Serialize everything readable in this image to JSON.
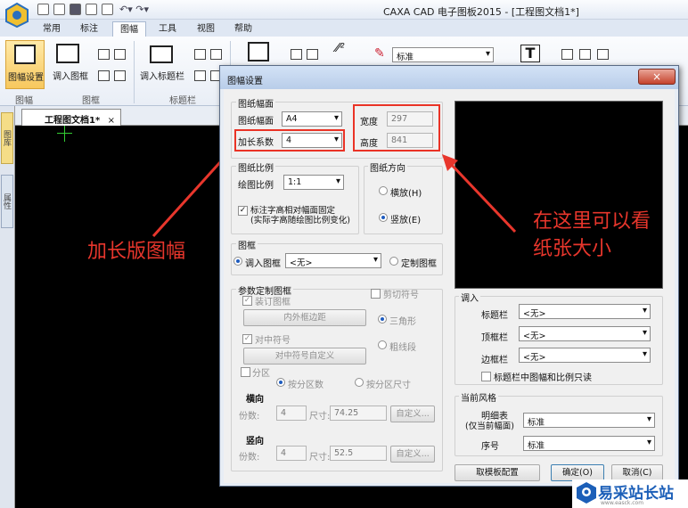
{
  "window": {
    "title": "CAXA CAD 电子图板2015 - [工程图文档1*]"
  },
  "ribbon": {
    "tabs": [
      "常用",
      "标注",
      "图幅",
      "工具",
      "视图",
      "帮助"
    ],
    "active_tab": "图幅",
    "buttons": {
      "sheet_setup": "图幅设置",
      "load_frame": "调入图框",
      "load_title_block": "调入标题栏",
      "style_value": "标准"
    },
    "groups": {
      "sheet": "图幅",
      "frame": "图框",
      "title_block": "标题栏"
    }
  },
  "left_panel": {
    "tab1": "图库",
    "tab2": "属性"
  },
  "document_tab": {
    "label": "工程图文档1*",
    "close": "×"
  },
  "dialog": {
    "title": "图幅设置",
    "close": "×",
    "sheet_size": {
      "legend": "图纸幅面",
      "size_label": "图纸幅面",
      "size_value": "A4",
      "factor_label": "加长系数",
      "factor_value": "4",
      "width_label": "宽度",
      "width_value": "297",
      "height_label": "高度",
      "height_value": "841"
    },
    "scale": {
      "legend": "图纸比例",
      "label": "绘图比例",
      "value": "1:1",
      "fixed_text_line1": "标注字高相对幅面固定",
      "fixed_text_line2": "(实际字高随绘图比例变化)"
    },
    "orientation": {
      "legend": "图纸方向",
      "landscape": "横放(H)",
      "portrait": "竖放(E)"
    },
    "frame": {
      "legend": "图框",
      "load_label": "调入图框",
      "load_value": "<无>",
      "custom_label": "定制图框"
    },
    "custom_params": {
      "legend": "参数定制图框",
      "binding_frame": "装订图框",
      "inner_outer_margin": "内外框边距",
      "center_mark": "对中符号",
      "center_mark_custom": "对中符号自定义",
      "cut_mark": "剪切符号",
      "triangle": "三角形",
      "thick_line": "粗线段",
      "zones": "分区",
      "by_zone_count": "按分区数",
      "by_zone_size": "按分区尺寸",
      "horizontal": "横向",
      "vertical": "竖向",
      "count_label": "份数:",
      "h_count": "4",
      "size_label": "尺寸:",
      "h_size": "74.25",
      "v_count": "4",
      "v_size": "52.5",
      "custom_button": "自定义..."
    },
    "load": {
      "legend": "调入",
      "title_block_label": "标题栏",
      "title_block_value": "<无>",
      "top_block_label": "顶框栏",
      "top_block_value": "<无>",
      "side_block_label": "边框栏",
      "side_block_value": "<无>",
      "readonly_label": "标题栏中图幅和比例只读"
    },
    "style": {
      "legend": "当前风格",
      "detail_label_line1": "明细表",
      "detail_label_line2": "(仅当前幅面)",
      "detail_value": "标准",
      "number_label": "序号",
      "number_value": "标准"
    },
    "buttons": {
      "template": "取模板配置",
      "ok": "确定(O)",
      "cancel": "取消(C)"
    }
  },
  "annotations": {
    "left": "加长版图幅",
    "right_line1": "在这里可以看",
    "right_line2": "纸张大小"
  },
  "watermark": {
    "text": "易采站长站",
    "sub": "www.easck.com"
  },
  "colors": {
    "annotation_red": "#e8362c",
    "canvas": "#000000",
    "dialog_bg": "#f0f0f0"
  }
}
